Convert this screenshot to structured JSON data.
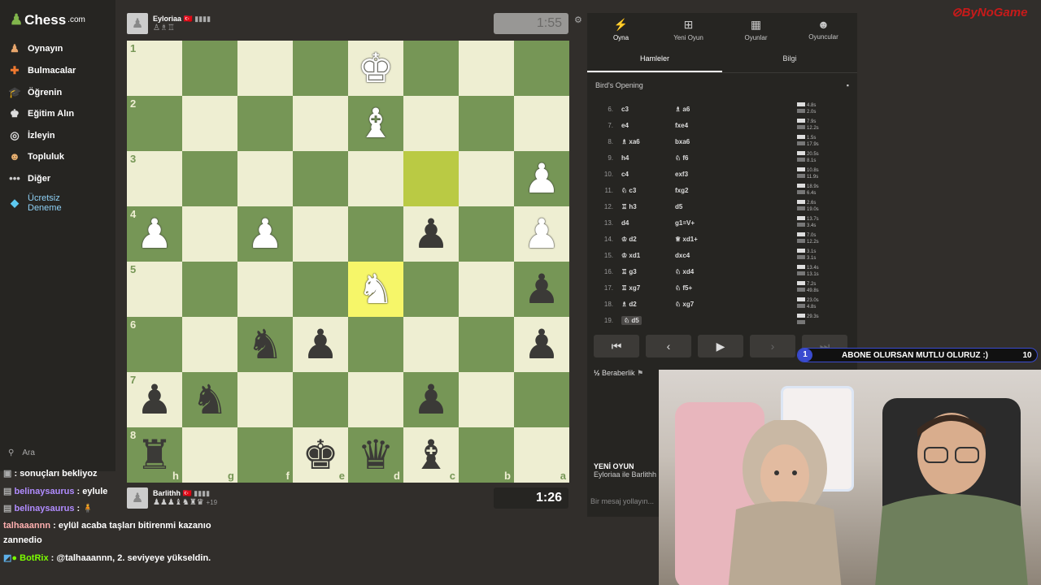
{
  "sidebar": {
    "logo": "Chess",
    "logo_suffix": ".com",
    "items": [
      {
        "label": "Oynayın",
        "icon": "pawn-icon"
      },
      {
        "label": "Bulmacalar",
        "icon": "puzzle-icon"
      },
      {
        "label": "Öğrenin",
        "icon": "graduation-icon"
      },
      {
        "label": "Eğitim Alın",
        "icon": "coach-icon"
      },
      {
        "label": "İzleyin",
        "icon": "binoculars-icon"
      },
      {
        "label": "Topluluk",
        "icon": "community-icon"
      },
      {
        "label": "Diğer",
        "icon": "more-icon"
      },
      {
        "label": "Ücretsiz Deneme",
        "icon": "diamond-icon"
      }
    ],
    "search": "Ara"
  },
  "players": {
    "top": {
      "name": "Eyloriaa",
      "flag": "🇹🇷",
      "captured": "♙♗♖",
      "clock": "1:55"
    },
    "bottom": {
      "name": "Barlithh",
      "flag": "🇹🇷",
      "captured": "♟♟♟♝♞♜♛",
      "diff": "+19",
      "clock": "1:26"
    }
  },
  "board": {
    "ranks": [
      "1",
      "2",
      "3",
      "4",
      "5",
      "6",
      "7",
      "8"
    ],
    "files": [
      "h",
      "g",
      "f",
      "e",
      "d",
      "c",
      "b",
      "a"
    ],
    "rows": [
      [
        "",
        "",
        "",
        "",
        "wK",
        "",
        "",
        ""
      ],
      [
        "",
        "",
        "",
        "",
        "wB",
        "",
        "",
        ""
      ],
      [
        "",
        "",
        "",
        "",
        "",
        "",
        "",
        "wP"
      ],
      [
        "wP",
        "",
        "wP",
        "",
        "",
        "bP",
        "",
        "wP"
      ],
      [
        "",
        "",
        "",
        "",
        "wN",
        "",
        "",
        "bP"
      ],
      [
        "",
        "",
        "bN",
        "bP",
        "",
        "",
        "",
        "bP"
      ],
      [
        "bP",
        "bN",
        "",
        "",
        "",
        "bP",
        "",
        ""
      ],
      [
        "bR",
        "",
        "",
        "bK",
        "bQ",
        "bB",
        "",
        ""
      ]
    ]
  },
  "panel": {
    "tabs": [
      {
        "label": "Oyna",
        "icon": "bolt-icon"
      },
      {
        "label": "Yeni Oyun",
        "icon": "plus-icon"
      },
      {
        "label": "Oyunlar",
        "icon": "grid-icon"
      },
      {
        "label": "Oyuncular",
        "icon": "players-icon"
      }
    ],
    "subtabs": [
      "Hamleler",
      "Bilgi"
    ],
    "opening": "Bird's Opening",
    "moves": [
      {
        "n": "6.",
        "w": "c3",
        "b": "♗ a6",
        "t1": "4.8s",
        "t2": "2.0s"
      },
      {
        "n": "7.",
        "w": "e4",
        "b": "fxe4",
        "t1": "7.9s",
        "t2": "12.2s"
      },
      {
        "n": "8.",
        "w": "♗ xa6",
        "b": "bxa6",
        "t1": "1.5s",
        "t2": "17.9s"
      },
      {
        "n": "9.",
        "w": "h4",
        "b": "♘ f6",
        "t1": "20.5s",
        "t2": "8.1s"
      },
      {
        "n": "10.",
        "w": "c4",
        "b": "exf3",
        "t1": "10.8s",
        "t2": "11.9s"
      },
      {
        "n": "11.",
        "w": "♘ c3",
        "b": "fxg2",
        "t1": "18.9s",
        "t2": "6.4s"
      },
      {
        "n": "12.",
        "w": "♖ h3",
        "b": "d5",
        "t1": "2.6s",
        "t2": "19.0s"
      },
      {
        "n": "13.",
        "w": "d4",
        "b": "g1=V+",
        "t1": "13.7s",
        "t2": "3.4s"
      },
      {
        "n": "14.",
        "w": "♔ d2",
        "b": "♕ xd1+",
        "t1": "7.0s",
        "t2": "12.2s"
      },
      {
        "n": "15.",
        "w": "♔ xd1",
        "b": "dxc4",
        "t1": "3.1s",
        "t2": "3.1s"
      },
      {
        "n": "16.",
        "w": "♖ g3",
        "b": "♘ xd4",
        "t1": "13.4s",
        "t2": "13.1s"
      },
      {
        "n": "17.",
        "w": "♖ xg7",
        "b": "♘ f5+",
        "t1": "7.2s",
        "t2": "49.8s"
      },
      {
        "n": "18.",
        "w": "♗ d2",
        "b": "♘ xg7",
        "t1": "23.0s",
        "t2": "4.8s"
      },
      {
        "n": "19.",
        "w": "♘ d5",
        "b": "",
        "t1": "29.3s",
        "t2": ""
      }
    ],
    "draw": "Beraberlik",
    "new_game_title": "YENİ OYUN",
    "new_game_sub": "Eyloriaa ile Barlithh",
    "msg_placeholder": "Bir mesaj yollayın..."
  },
  "overlay": {
    "banner_num": "1",
    "banner_text": "ABONE OLURSAN MUTLU OLURUZ :)",
    "banner_count": "10",
    "brand": "ByNoGame"
  },
  "chat": [
    {
      "user": "",
      "text": ": sonuçları bekliyoz"
    },
    {
      "user": "belinaysaurus",
      "text": ": eylule"
    },
    {
      "user": "belinaysaurus",
      "text": ":"
    },
    {
      "user": "talhaaannn",
      "text": ": eylül acaba taşları bitirenmi kazanıo"
    },
    {
      "user": "",
      "text": "zannedio"
    },
    {
      "user": "BotRix",
      "text": ": @talhaaannn, 2. seviyeye yükseldin."
    }
  ]
}
